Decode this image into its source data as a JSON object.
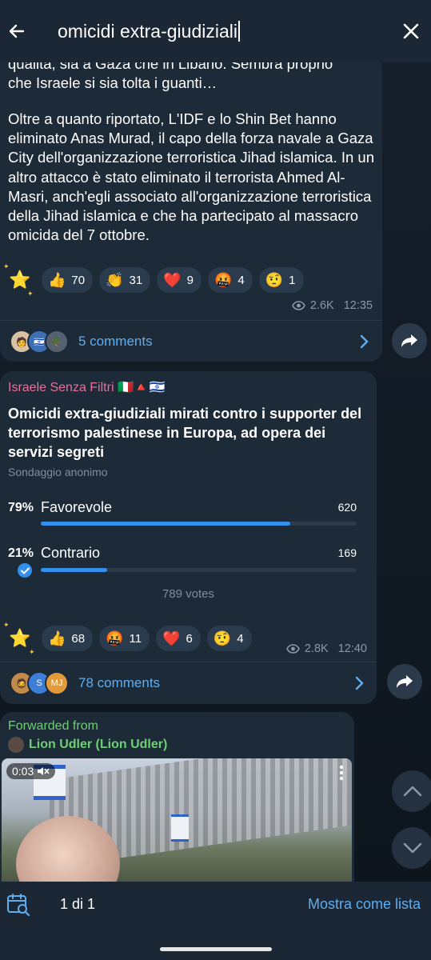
{
  "search": {
    "query": "omicidi extra-giudiziali"
  },
  "message1": {
    "text_partial_lines": [
      "qualità, sia a Gaza che in Libano. Sembra proprio",
      "che Israele si sia tolta i guanti…"
    ],
    "text": "Oltre a quanto riportato, L'IDF e lo Shin Bet hanno eliminato Anas Murad, il capo della forza navale a Gaza City dell'organizzazione terroristica Jihad islamica. In un altro attacco è stato eliminato il terrorista Ahmed Al-Masri, anch'egli associato all'organizzazione terroristica della Jihad islamica e che ha partecipato al massacro omicida del 7 ottobre.",
    "reactions": [
      {
        "icon": "thumbs-up-icon",
        "emoji": "👍",
        "count": "70"
      },
      {
        "icon": "clap-icon",
        "emoji": "👏",
        "count": "31"
      },
      {
        "icon": "heart-icon",
        "emoji": "❤️",
        "count": "9"
      },
      {
        "icon": "angry-face-icon",
        "emoji": "🤬",
        "count": "4"
      },
      {
        "icon": "raised-eyebrow-icon",
        "emoji": "🤨",
        "count": "1"
      }
    ],
    "views": "2.6K",
    "time": "12:35",
    "comments_label": "5 comments"
  },
  "message2": {
    "channel": "Israele Senza Filtri 🇮🇹🔺🇮🇱",
    "poll_question": "Omicidi extra-giudiziali mirati contro i supporter del terrorismo palestinese in Europa, ad opera dei servizi segreti",
    "poll_type": "Sondaggio anonimo",
    "options": [
      {
        "percent": "79%",
        "label": "Favorevole",
        "count": "620",
        "fraction": 0.79,
        "selected": false
      },
      {
        "percent": "21%",
        "label": "Contrario",
        "count": "169",
        "fraction": 0.21,
        "selected": true
      }
    ],
    "votes": "789 votes",
    "reactions": [
      {
        "icon": "thumbs-up-icon",
        "emoji": "👍",
        "count": "68"
      },
      {
        "icon": "angry-face-icon",
        "emoji": "🤬",
        "count": "11"
      },
      {
        "icon": "heart-icon",
        "emoji": "❤️",
        "count": "6"
      },
      {
        "icon": "raised-eyebrow-icon",
        "emoji": "🤨",
        "count": "4"
      }
    ],
    "views": "2.8K",
    "time": "12:40",
    "comments_label": "78 comments",
    "avatar_initials": [
      "S",
      "MJ"
    ]
  },
  "message3": {
    "forwarded_label": "Forwarded from",
    "forwarded_from": "Lion Udler (Lion Udler)",
    "video_time": "0:03"
  },
  "bottom": {
    "result_count": "1 di 1",
    "list_label": "Mostra come lista"
  },
  "colors": {
    "accent": "#5eaef2",
    "channel_name": "#e8709a",
    "forwarded": "#6fcf74",
    "bubble": "#1d2a38",
    "poll_bar": "#3390ec"
  }
}
